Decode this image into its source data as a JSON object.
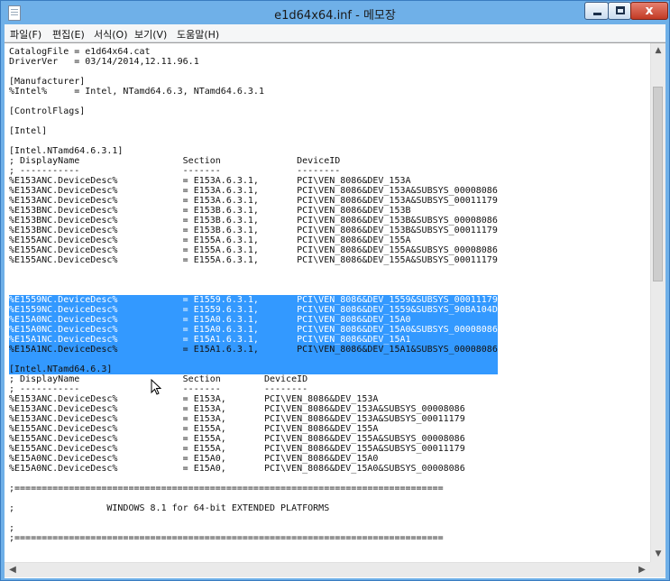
{
  "window": {
    "title": "e1d64x64.inf - 메모장",
    "close_glyph": "x"
  },
  "menu": {
    "items": [
      "파일(F)",
      "편집(E)",
      "서식(O)",
      "보기(V)",
      "도움말(H)"
    ]
  },
  "editor": {
    "lines": [
      "CatalogFile = e1d64x64.cat",
      "DriverVer   = 03/14/2014,12.11.96.1",
      "",
      "[Manufacturer]",
      "%Intel%     = Intel, NTamd64.6.3, NTamd64.6.3.1",
      "",
      "[ControlFlags]",
      "",
      "[Intel]",
      "",
      "[Intel.NTamd64.6.3.1]",
      "; DisplayName                   Section              DeviceID",
      "; -----------                   -------              --------",
      "%E153ANC.DeviceDesc%            = E153A.6.3.1,       PCI\\VEN_8086&DEV_153A",
      "%E153ANC.DeviceDesc%            = E153A.6.3.1,       PCI\\VEN_8086&DEV_153A&SUBSYS_00008086",
      "%E153ANC.DeviceDesc%            = E153A.6.3.1,       PCI\\VEN_8086&DEV_153A&SUBSYS_00011179",
      "%E153BNC.DeviceDesc%            = E153B.6.3.1,       PCI\\VEN_8086&DEV_153B",
      "%E153BNC.DeviceDesc%            = E153B.6.3.1,       PCI\\VEN_8086&DEV_153B&SUBSYS_00008086",
      "%E153BNC.DeviceDesc%            = E153B.6.3.1,       PCI\\VEN_8086&DEV_153B&SUBSYS_00011179",
      "%E155ANC.DeviceDesc%            = E155A.6.3.1,       PCI\\VEN_8086&DEV_155A",
      "%E155ANC.DeviceDesc%            = E155A.6.3.1,       PCI\\VEN_8086&DEV_155A&SUBSYS_00008086",
      "%E155ANC.DeviceDesc%            = E155A.6.3.1,       PCI\\VEN_8086&DEV_155A&SUBSYS_00011179",
      "%E155ANC.DeviceDesc%            = E155A.6.3.1,       PCI\\VEN_8086&DEV_155A&SUBSYS_90BA104D",
      "%E1559NC.DeviceDesc%            = E1559.6.3.1,       PCI\\VEN_8086&DEV_1559",
      "%E1559NC.DeviceDesc%            = E1559.6.3.1,       PCI\\VEN_8086&DEV_1559&SUBSYS_00008086",
      "%E1559NC.DeviceDesc%            = E1559.6.3.1,       PCI\\VEN_8086&DEV_1559&SUBSYS_00011179",
      "%E1559NC.DeviceDesc%            = E1559.6.3.1,       PCI\\VEN_8086&DEV_1559&SUBSYS_90BA104D",
      "%E15A0NC.DeviceDesc%            = E15A0.6.3.1,       PCI\\VEN_8086&DEV_15A0",
      "%E15A0NC.DeviceDesc%            = E15A0.6.3.1,       PCI\\VEN_8086&DEV_15A0&SUBSYS_00008086",
      "%E15A1NC.DeviceDesc%            = E15A1.6.3.1,       PCI\\VEN_8086&DEV_15A1",
      "%E15A1NC.DeviceDesc%            = E15A1.6.3.1,       PCI\\VEN_8086&DEV_15A1&SUBSYS_00008086",
      "",
      "[Intel.NTamd64.6.3]",
      "; DisplayName                   Section        DeviceID",
      "; -----------                   -------        --------",
      "%E153ANC.DeviceDesc%            = E153A,       PCI\\VEN_8086&DEV_153A",
      "%E153ANC.DeviceDesc%            = E153A,       PCI\\VEN_8086&DEV_153A&SUBSYS_00008086",
      "%E153ANC.DeviceDesc%            = E153A,       PCI\\VEN_8086&DEV_153A&SUBSYS_00011179",
      "%E155ANC.DeviceDesc%            = E155A,       PCI\\VEN_8086&DEV_155A",
      "%E155ANC.DeviceDesc%            = E155A,       PCI\\VEN_8086&DEV_155A&SUBSYS_00008086",
      "%E155ANC.DeviceDesc%            = E155A,       PCI\\VEN_8086&DEV_155A&SUBSYS_00011179",
      "%E15A0NC.DeviceDesc%            = E15A0,       PCI\\VEN_8086&DEV_15A0",
      "%E15A0NC.DeviceDesc%            = E15A0,       PCI\\VEN_8086&DEV_15A0&SUBSYS_00008086",
      "",
      ";===============================================================================",
      "",
      ";                 WINDOWS 8.1 for 64-bit EXTENDED PLATFORMS",
      "",
      ";",
      ";==============================================================================="
    ],
    "selected_from_line": 22,
    "selected_to_line": 29
  },
  "colors": {
    "titlebar": "#6fb0e8",
    "selection": "#3399ff",
    "selected_text": "#ffffff"
  }
}
